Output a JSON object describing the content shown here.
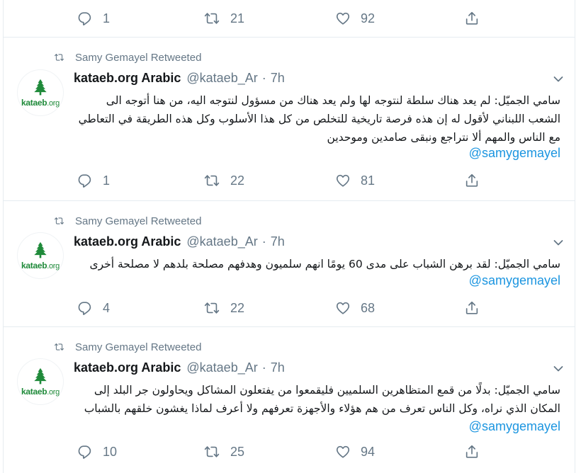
{
  "top_actions": {
    "reply_count": "1",
    "retweet_count": "21",
    "like_count": "92"
  },
  "tweets": [
    {
      "retweeted_by": "Samy Gemayel Retweeted",
      "author_name": "kataeb.org Arabic",
      "author_handle": "@kataeb_Ar",
      "separator": "·",
      "time": "7h",
      "avatar_brand": "kataeb",
      "avatar_brand_suffix": ".org",
      "text": "سامي الجميّل: لم يعد هناك سلطة لنتوجه لها ولم يعد هناك من مسؤول لنتوجه اليه، من هنا أتوجه الى الشعب اللبناني لأقول له إن هذه فرصة تاريخية للتخلص من كل هذا الأسلوب وكل هذه الطريقة في التعاطي مع الناس والمهم ألا نتراجع ونبقى صامدين وموحدين",
      "mention": "@samygemayel",
      "reply_count": "1",
      "retweet_count": "22",
      "like_count": "81"
    },
    {
      "retweeted_by": "Samy Gemayel Retweeted",
      "author_name": "kataeb.org Arabic",
      "author_handle": "@kataeb_Ar",
      "separator": "·",
      "time": "7h",
      "avatar_brand": "kataeb",
      "avatar_brand_suffix": ".org",
      "text": "سامي الجميّل: لقد برهن الشباب على مدى 60 يومًا انهم سلميون وهدفهم مصلحة بلدهم  لا مصلحة أخرى",
      "mention": "@samygemayel",
      "reply_count": "4",
      "retweet_count": "22",
      "like_count": "68"
    },
    {
      "retweeted_by": "Samy Gemayel Retweeted",
      "author_name": "kataeb.org Arabic",
      "author_handle": "@kataeb_Ar",
      "separator": "·",
      "time": "7h",
      "avatar_brand": "kataeb",
      "avatar_brand_suffix": ".org",
      "text": "سامي الجميّل: بدلًا من قمع المتظاهرين السلميين فليقمعوا من يفتعلون المشاكل ويحاولون جر البلد إلى المكان الذي نراه، وكل الناس تعرف من هم هؤلاء والأجهزة تعرفهم ولا أعرف لماذا يغشون خلقهم بالشباب",
      "mention": "@samygemayel",
      "reply_count": "10",
      "retweet_count": "25",
      "like_count": "94"
    }
  ],
  "icons": {
    "reply": "reply-icon",
    "retweet": "retweet-icon",
    "like": "heart-icon",
    "share": "share-icon",
    "caret": "chevron-down-icon",
    "retweeted_marker": "retweet-small-icon",
    "avatar_logo": "cedar-logo-icon"
  },
  "colors": {
    "text_primary": "#14171a",
    "text_secondary": "#657786",
    "link": "#1b95e0",
    "divider": "#e6ecf0",
    "brand_green": "#1f8a3a"
  }
}
